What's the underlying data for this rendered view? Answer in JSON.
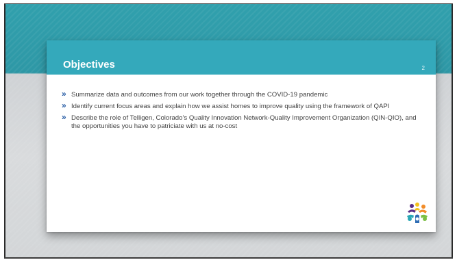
{
  "slide": {
    "title": "Objectives",
    "page_number": "2",
    "bullets": [
      "Summarize data and outcomes from our work together through the COVID-19 pandemic",
      "Identify current focus areas and explain how we assist homes to improve quality using the framework of QAPI",
      "Describe the role of Telligen, Colorado’s Quality Innovation Network-Quality Improvement Organization (QIN-QIO), and the opportunities you have to patriciate with us at no-cost"
    ],
    "bullet_marker": "»",
    "logo_icon": "people-circle-logo-icon"
  },
  "colors": {
    "header": "#34a9bb",
    "background_top": "#31a0ad",
    "background_bottom": "#d9dbdd",
    "bullet_marker": "#2f62a8",
    "text": "#404040",
    "logo_orange": "#f28c28",
    "logo_yellow": "#f6c21c",
    "logo_purple": "#5b2d86",
    "logo_teal": "#2aa7b6",
    "logo_green": "#7bbf44",
    "logo_blue": "#2e6db4"
  }
}
